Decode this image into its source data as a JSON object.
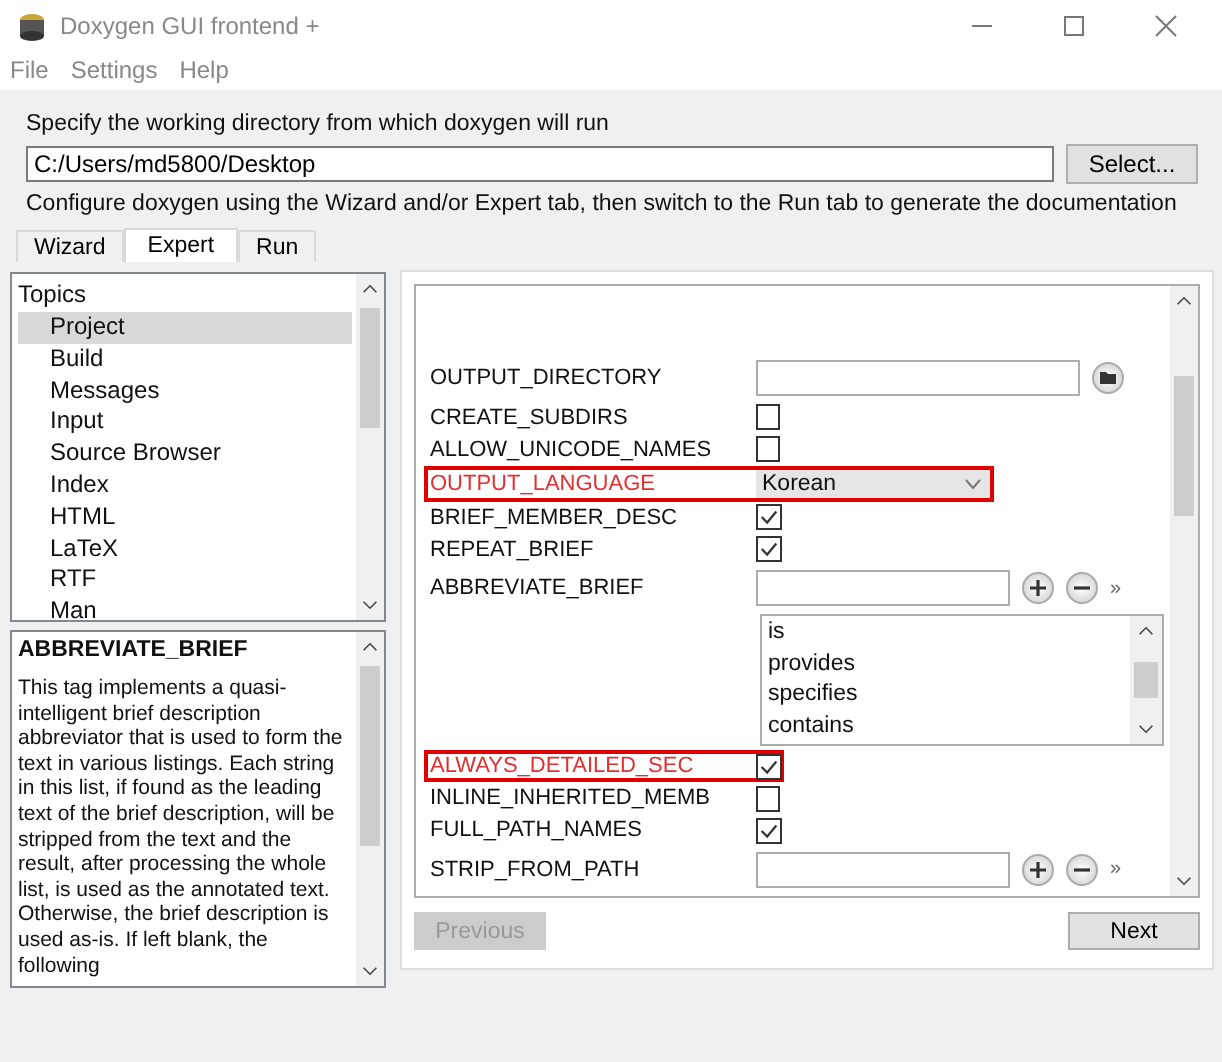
{
  "window": {
    "title": "Doxygen GUI frontend +"
  },
  "menu": [
    "File",
    "Settings",
    "Help"
  ],
  "workdir": {
    "label": "Specify the working directory from which doxygen will run",
    "value": "C:/Users/md5800/Desktop",
    "button": "Select..."
  },
  "hint": "Configure doxygen using the Wizard and/or Expert tab, then switch to the Run tab to generate the documentation",
  "tabs": [
    {
      "label": "Wizard",
      "selected": false
    },
    {
      "label": "Expert",
      "selected": true
    },
    {
      "label": "Run",
      "selected": false
    }
  ],
  "topics": {
    "title": "Topics",
    "items": [
      {
        "label": "Project",
        "selected": true
      },
      {
        "label": "Build",
        "selected": false
      },
      {
        "label": "Messages",
        "selected": false
      },
      {
        "label": "Input",
        "selected": false
      },
      {
        "label": "Source Browser",
        "selected": false
      },
      {
        "label": "Index",
        "selected": false
      },
      {
        "label": "HTML",
        "selected": false
      },
      {
        "label": "LaTeX",
        "selected": false
      },
      {
        "label": "RTF",
        "selected": false
      },
      {
        "label": "Man",
        "selected": false
      }
    ]
  },
  "help": {
    "title": "ABBREVIATE_BRIEF",
    "text": "This tag implements a quasi-intelligent brief description abbreviator that is used to form the text in various listings. Each string in this list, if found as the leading text of the brief description, will be stripped from the text and the result, after processing the whole list, is used as the annotated text. Otherwise, the brief description is used as-is. If left blank, the following"
  },
  "settings": [
    {
      "kind": "folder",
      "name": "OUTPUT_DIRECTORY",
      "highlighted": false
    },
    {
      "kind": "check",
      "name": "CREATE_SUBDIRS",
      "checked": false,
      "highlighted": false
    },
    {
      "kind": "check",
      "name": "ALLOW_UNICODE_NAMES",
      "checked": false,
      "highlighted": false
    },
    {
      "kind": "combo",
      "name": "OUTPUT_LANGUAGE",
      "value": "Korean",
      "highlighted": true
    },
    {
      "kind": "check",
      "name": "BRIEF_MEMBER_DESC",
      "checked": true,
      "highlighted": false
    },
    {
      "kind": "check",
      "name": "REPEAT_BRIEF",
      "checked": true,
      "highlighted": false
    },
    {
      "kind": "list",
      "name": "ABBREVIATE_BRIEF",
      "more": "»",
      "highlighted": false
    },
    {
      "kind": "values",
      "items": [
        "is",
        "provides",
        "specifies",
        "contains"
      ]
    },
    {
      "kind": "check",
      "name": "ALWAYS_DETAILED_SEC",
      "checked": true,
      "highlighted": true
    },
    {
      "kind": "check",
      "name": "INLINE_INHERITED_MEMB",
      "checked": false,
      "highlighted": false
    },
    {
      "kind": "check",
      "name": "FULL_PATH_NAMES",
      "checked": true,
      "highlighted": false
    },
    {
      "kind": "list",
      "name": "STRIP_FROM_PATH",
      "more": "»",
      "highlighted": false
    }
  ],
  "buttons": {
    "previous": {
      "label": "Previous",
      "disabled": true
    },
    "next": {
      "label": "Next",
      "disabled": false
    }
  }
}
